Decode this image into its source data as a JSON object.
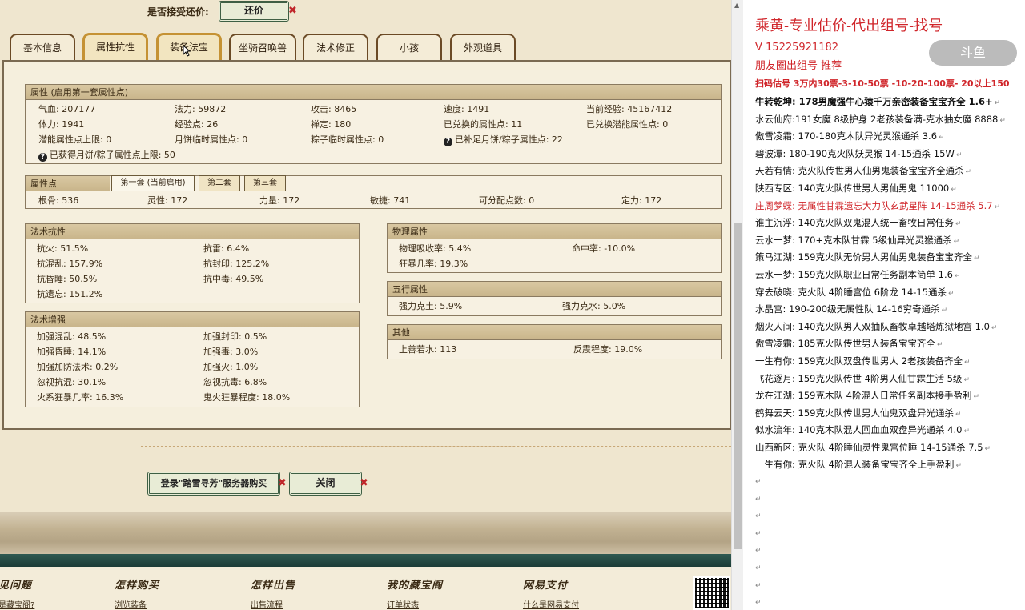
{
  "offer": {
    "label": "是否接受还价:",
    "button": "还价",
    "close_mark": "✖"
  },
  "tabs": [
    "基本信息",
    "属性抗性",
    "装备法宝",
    "坐骑召唤兽",
    "法术修正",
    "小孩",
    "外观道具"
  ],
  "attr": {
    "title": "属性 (启用第一套属性点)",
    "rows": [
      [
        "气血: 207177",
        "法力: 59872",
        "攻击: 8465",
        "速度: 1491",
        "当前经验: 45167412"
      ],
      [
        "体力: 1941",
        "经验点: 26",
        "禅定: 180",
        "已兑换的属性点: 11",
        "已兑换潜能属性点: 0"
      ],
      [
        "潜能属性点上限: 0",
        "月饼临时属性点: 0",
        "粽子临时属性点: 0",
        "已补足月饼/粽子属性点: 22",
        ""
      ]
    ],
    "last": "已获得月饼/粽子属性点上限: 50"
  },
  "points": {
    "title": "属性点",
    "subtabs": [
      "第一套 (当前启用)",
      "第二套",
      "第三套"
    ],
    "row": [
      "根骨: 536",
      "灵性: 172",
      "力量: 172",
      "敏捷: 741",
      "可分配点数: 0",
      "定力: 172"
    ]
  },
  "resist": {
    "title": "法术抗性",
    "rows": [
      [
        "抗火: 51.5%",
        "抗雷: 6.4%"
      ],
      [
        "抗混乱: 157.9%",
        "抗封印: 125.2%"
      ],
      [
        "抗昏睡: 50.5%",
        "抗中毒: 49.5%"
      ],
      [
        "抗遗忘: 151.2%",
        ""
      ]
    ]
  },
  "boost": {
    "title": "法术增强",
    "rows": [
      [
        "加强混乱: 48.5%",
        "加强封印: 0.5%"
      ],
      [
        "加强昏睡: 14.1%",
        "加强毒: 3.0%"
      ],
      [
        "加强加防法术: 0.2%",
        "加强火: 1.0%"
      ],
      [
        "忽视抗混: 30.1%",
        "忽视抗毒: 6.8%"
      ],
      [
        "火系狂暴几率: 16.3%",
        "鬼火狂暴程度: 18.0%"
      ]
    ]
  },
  "physical": {
    "title": "物理属性",
    "rows": [
      [
        "物理吸收率: 5.4%",
        "命中率: -10.0%"
      ],
      [
        "狂暴几率: 19.3%",
        ""
      ]
    ]
  },
  "wuxing": {
    "title": "五行属性",
    "rows": [
      [
        "强力克土: 5.9%",
        "强力克水: 5.0%"
      ]
    ]
  },
  "other": {
    "title": "其他",
    "rows": [
      [
        "上善若水: 113",
        "反震程度: 19.0%"
      ]
    ]
  },
  "actions": {
    "login": "登录\"踏雪寻芳\"服务器购买",
    "close": "关闭"
  },
  "footer": {
    "cols": [
      {
        "title": "见问题",
        "link": "是藏宝阁?"
      },
      {
        "title": "怎样购买",
        "link": "浏览装备"
      },
      {
        "title": "怎样出售",
        "link": "出售流程"
      },
      {
        "title": "我的藏宝阁",
        "link": "订单状态"
      },
      {
        "title": "网易支付",
        "link": "什么是网易支付"
      }
    ]
  },
  "notes": {
    "title": "乘黄-专业估价-代出组号-找号",
    "phone": "V   15225921182",
    "circle": "朋友圈出组号  推荐",
    "scan": "扫码估号 3万内30票-3-10-50票  -10-20-100票- 20以上150",
    "watermark": "斗鱼",
    "lines": [
      {
        "text": "牛转乾坤: 178男魔强牛心猿千万亲密装备宝宝齐全 1.6+",
        "style": "bold"
      },
      {
        "text": "水云仙府:191女魔 8级护身 2老孩装备满-克水抽女魔 8888",
        "style": ""
      },
      {
        "text": "傲雪凌霜: 170-180克木队异光灵猴通杀 3.6",
        "style": ""
      },
      {
        "text": "碧波潭: 180-190克火队妖灵猴 14-15通杀 15W",
        "style": ""
      },
      {
        "text": "天若有情: 克火队传世男人仙男鬼装备宝宝齐全通杀",
        "style": ""
      },
      {
        "text": "陕西专区: 140克火队传世男人男仙男鬼 11000",
        "style": ""
      },
      {
        "text": "庄周梦蝶: 无属性甘霖遗忘大力队玄武星阵 14-15通杀 5.7",
        "style": "red"
      },
      {
        "text": "谁主沉浮: 140克火队双鬼混人统一畜牧日常任务",
        "style": ""
      },
      {
        "text": "云水一梦: 170+克木队甘霖 5级仙异光灵猴通杀",
        "style": ""
      },
      {
        "text": "策马江湖: 159克火队无价男人男仙男鬼装备宝宝齐全",
        "style": ""
      },
      {
        "text": "云水一梦: 159克火队职业日常任务副本简单 1.6",
        "style": ""
      },
      {
        "text": "穿去破晓: 克火队 4阶睡宫位 6阶龙 14-15通杀",
        "style": ""
      },
      {
        "text": "水晶宫: 190-200级无属性队 14-16穷奇通杀",
        "style": ""
      },
      {
        "text": "烟火人间: 140克火队男人双抽队畜牧卓越塔炼狱地宫 1.0",
        "style": ""
      },
      {
        "text": "傲雪凌霜: 185克火队传世男人装备宝宝齐全",
        "style": ""
      },
      {
        "text": "一生有你: 159克火队双盘传世男人 2老孩装备齐全",
        "style": ""
      },
      {
        "text": "飞花逐月: 159克火队传世 4阶男人仙甘霖生活 5级",
        "style": ""
      },
      {
        "text": "龙在江湖: 159克木队 4阶混人日常任务副本接手盈利",
        "style": ""
      },
      {
        "text": "鹤舞云天: 159克火队传世男人仙鬼双盘异光通杀",
        "style": ""
      },
      {
        "text": "似水流年: 140克木队混人回血血双盘异光通杀 4.0",
        "style": ""
      },
      {
        "text": "山西新区: 克火队 4阶睡仙灵性鬼宫位睡 14-15通杀 7.5",
        "style": ""
      },
      {
        "text": "一生有你: 克火队 4阶混人装备宝宝齐全上手盈利",
        "style": ""
      }
    ],
    "ret_mark": "↵",
    "empty_count": 8
  }
}
